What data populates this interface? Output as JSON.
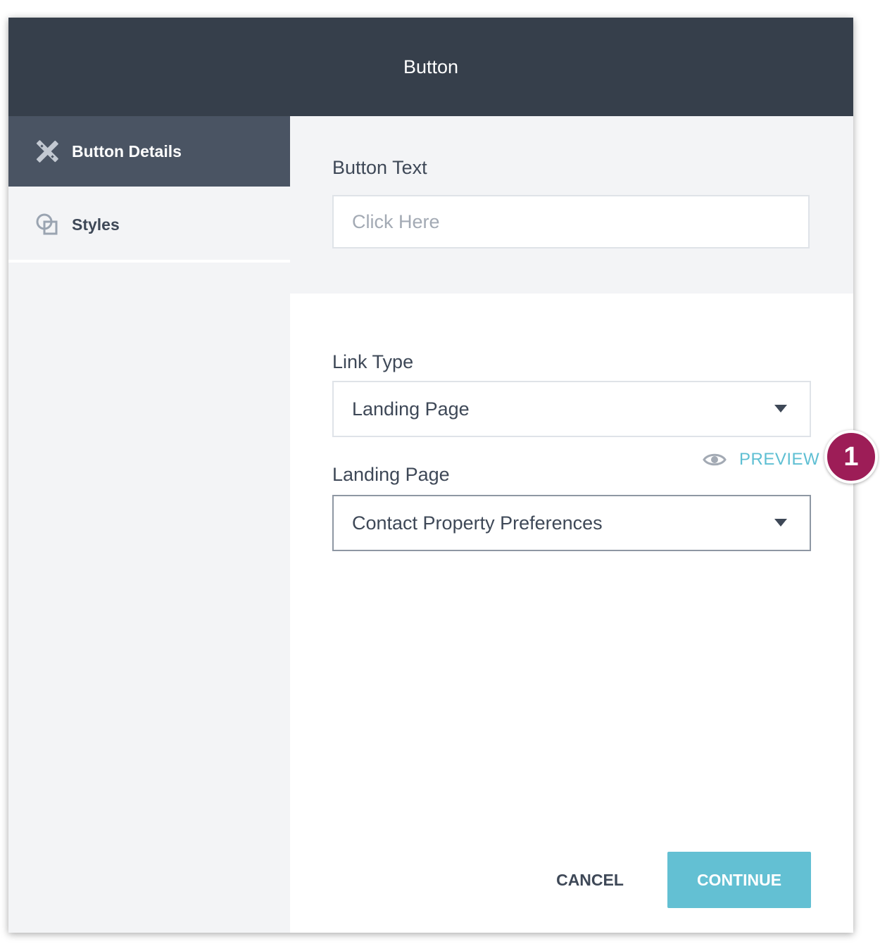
{
  "dialog": {
    "title": "Button"
  },
  "sidebar": {
    "items": [
      {
        "label": "Button Details",
        "icon": "pencil-ruler-icon",
        "active": true
      },
      {
        "label": "Styles",
        "icon": "overlapping-squares-icon",
        "active": false
      }
    ]
  },
  "form": {
    "button_text": {
      "label": "Button Text",
      "placeholder": "Click Here"
    },
    "link_type": {
      "label": "Link Type",
      "value": "Landing Page"
    },
    "landing_page": {
      "label": "Landing Page",
      "value": "Contact Property Preferences",
      "preview_label": "PREVIEW",
      "preview_icon": "eye-icon"
    }
  },
  "actions": {
    "cancel_label": "CANCEL",
    "continue_label": "CONTINUE"
  },
  "annotation": {
    "badge": "1"
  },
  "colors": {
    "header": "#363f4b",
    "active_tab": "#4a5463",
    "accent": "#63c0d3",
    "badge": "#9d1d57"
  }
}
